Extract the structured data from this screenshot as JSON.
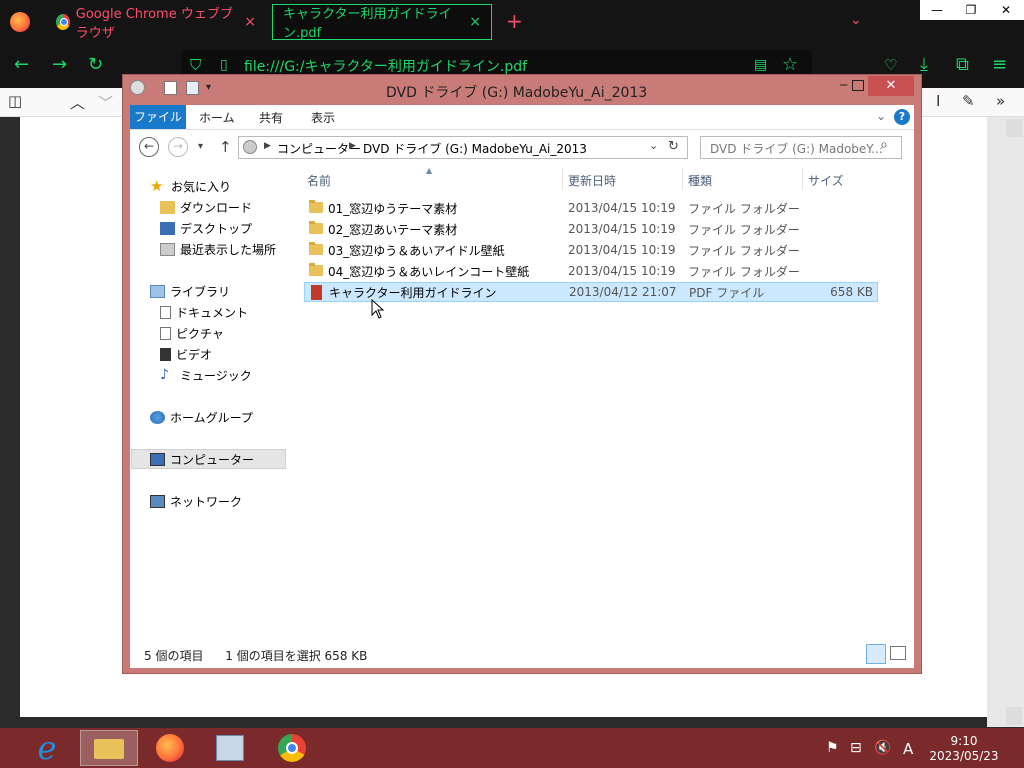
{
  "browser": {
    "tabs": [
      {
        "label": "Google Chrome ウェブブラウザ",
        "close": "×"
      },
      {
        "label": "キャラクター利用ガイドライン.pdf",
        "close": "×"
      }
    ],
    "new_tab": "+",
    "tab_list": "⌄",
    "window_controls": {
      "minimize": "—",
      "maximize": "❐",
      "close": "✕"
    },
    "url": "file:///G:/キャラクター利用ガイドライン.pdf",
    "accent_color": "#1dd76a",
    "tab_color": "#ff4d6d"
  },
  "explorer": {
    "title": "DVD ドライブ (G:) MadobeYu_Ai_2013",
    "ribbon_tabs": [
      "ファイル",
      "ホーム",
      "共有",
      "表示"
    ],
    "breadcrumb": [
      "コンピューター",
      "DVD ドライブ (G:) MadobeYu_Ai_2013"
    ],
    "search_placeholder": "DVD ドライブ (G:) MadobeY...",
    "nav_pane": {
      "favorites": {
        "label": "お気に入り",
        "items": [
          "ダウンロード",
          "デスクトップ",
          "最近表示した場所"
        ]
      },
      "libraries": {
        "label": "ライブラリ",
        "items": [
          "ドキュメント",
          "ピクチャ",
          "ビデオ",
          "ミュージック"
        ]
      },
      "homegroup": "ホームグループ",
      "computer": "コンピューター",
      "network": "ネットワーク"
    },
    "columns": [
      "名前",
      "更新日時",
      "種類",
      "サイズ"
    ],
    "files": [
      {
        "name": "01_窓辺ゆうテーマ素材",
        "date": "2013/04/15 10:19",
        "type": "ファイル フォルダー",
        "size": "",
        "icon": "folder-icon"
      },
      {
        "name": "02_窓辺あいテーマ素材",
        "date": "2013/04/15 10:19",
        "type": "ファイル フォルダー",
        "size": "",
        "icon": "folder-icon"
      },
      {
        "name": "03_窓辺ゆう＆あいアイドル壁紙",
        "date": "2013/04/15 10:19",
        "type": "ファイル フォルダー",
        "size": "",
        "icon": "folder-icon"
      },
      {
        "name": "04_窓辺ゆう＆あいレインコート壁紙",
        "date": "2013/04/15 10:19",
        "type": "ファイル フォルダー",
        "size": "",
        "icon": "folder-icon"
      },
      {
        "name": "キャラクター利用ガイドライン",
        "date": "2013/04/12 21:07",
        "type": "PDF ファイル",
        "size": "658 KB",
        "icon": "pdf-file-icon",
        "selected": true
      }
    ],
    "status": {
      "count": "5 個の項目",
      "selection": "1 個の項目を選択  658 KB"
    }
  },
  "taskbar": {
    "apps": [
      "internet-explorer-icon",
      "file-explorer-icon",
      "firefox-icon",
      "media-center-icon",
      "chrome-icon"
    ],
    "ime": "A",
    "time": "9:10",
    "date": "2023/05/23"
  }
}
